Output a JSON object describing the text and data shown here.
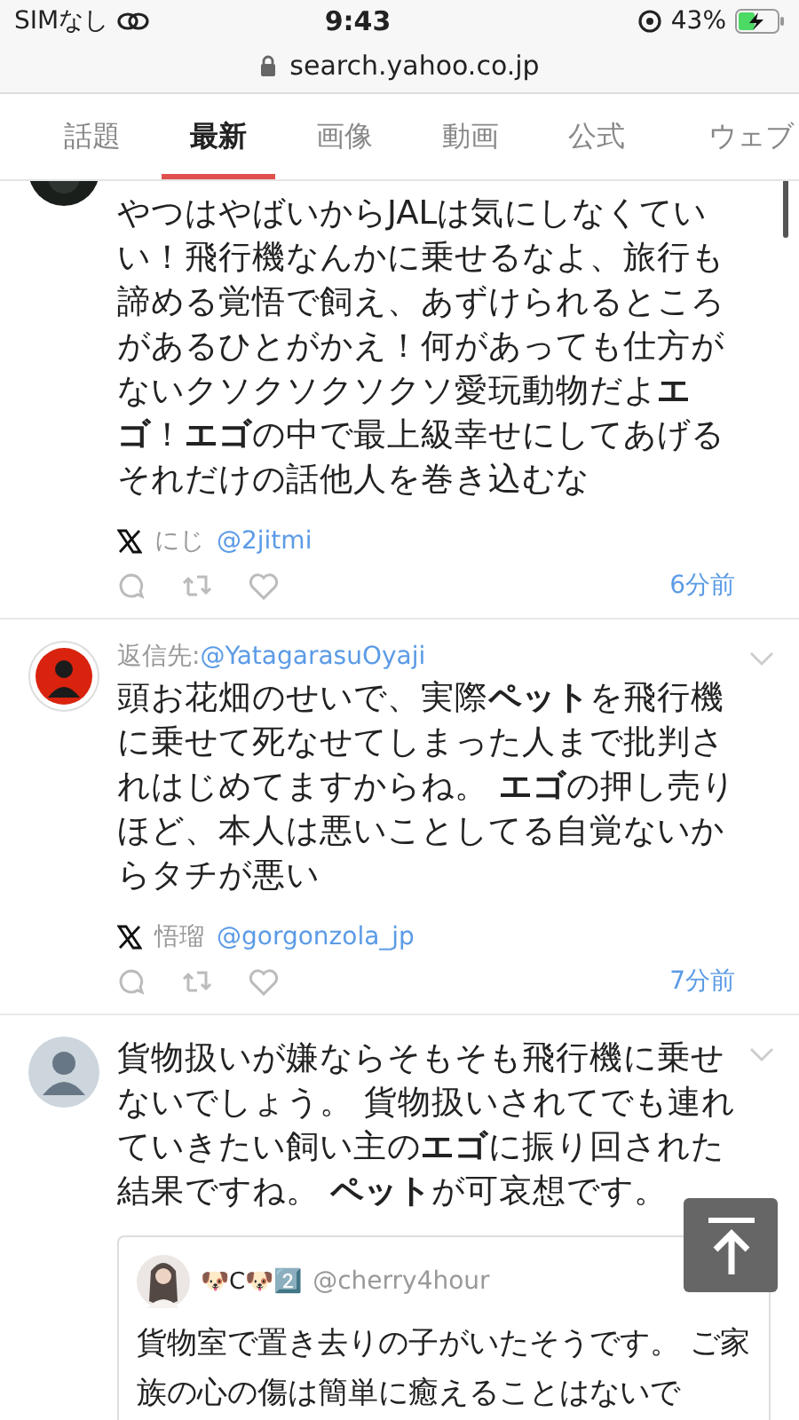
{
  "status_bar": {
    "carrier": "SIMなし",
    "time": "9:43",
    "battery": "43%"
  },
  "address_bar": {
    "url": "search.yahoo.co.jp"
  },
  "tabs": [
    {
      "label": "話題",
      "selected": false
    },
    {
      "label": "最新",
      "selected": true
    },
    {
      "label": "画像",
      "selected": false
    },
    {
      "label": "動画",
      "selected": false
    },
    {
      "label": "公式",
      "selected": false
    },
    {
      "label": "ウェブ",
      "selected": false
    }
  ],
  "posts": [
    {
      "avatar": {
        "kind": "photo"
      },
      "text": "やつはやばいからJALは気にしなくていい！飛行機なんかに乗せるなよ、旅行も諦める覚悟で飼え、あずけられるところがあるひとがかえ！何があっても仕方がないクソクソクソクソ愛玩動物だよ**エゴ**！**エゴ**の中で最上級幸せにしてあげるそれだけの話他人を巻き込むな",
      "source_name": "にじ",
      "handle": "@2jitmi",
      "time": "6分前"
    },
    {
      "avatar": {
        "kind": "emblem"
      },
      "reply_label": "返信先:",
      "reply_to": "@YatagarasuOyaji",
      "text": "頭お花畑のせいで、実際**ペット**を飛行機に乗せて死なせてしまった人まで批判されはじめてますからね。 **エゴ**の押し売りほど、本人は悪いことしてる自覚ないからタチが悪い",
      "source_name": "悟瑠",
      "handle": "@gorgonzola_jp",
      "time": "7分前"
    },
    {
      "avatar": {
        "kind": "default"
      },
      "text": "貨物扱いが嫌ならそもそも飛行機に乗せないでしょう。 貨物扱いされてでも連れていきたい飼い主の**エゴ**に振り回された結果ですね。 **ペット**が可哀想です。",
      "quote": {
        "name": "🐶C🐶2️⃣",
        "handle": "@cherry4hour",
        "text": "貨物室で置き去りの子がいたそうです。 ご家族の心の傷は簡単に癒えることはないで"
      }
    }
  ]
}
